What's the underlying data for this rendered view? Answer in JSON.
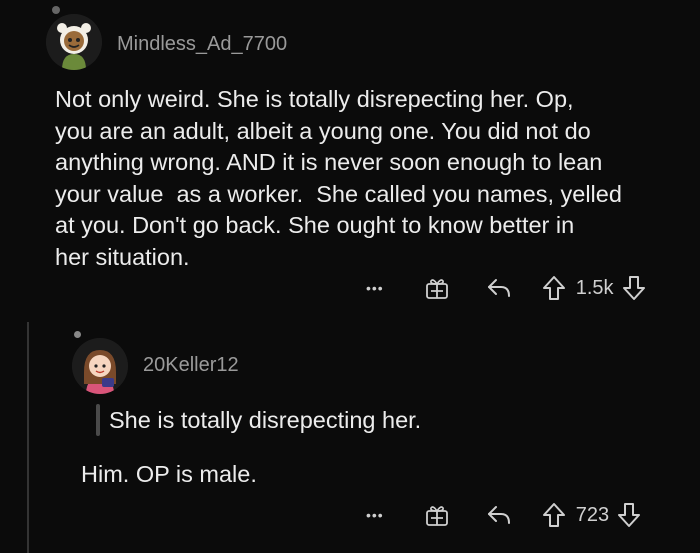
{
  "comments": [
    {
      "username": "Mindless_Ad_7700",
      "body": "Not only weird. She is totally disrepecting her. Op,\nyou are an adult, albeit a young one. You did not do\nanything wrong. AND it is never soon enough to lean\nyour value  as a worker.  She called you names, yelled\nat you. Don't go back. She ought to know better in\nher situation.",
      "actions": {
        "more": "•••",
        "vote_count": "1.5k"
      }
    },
    {
      "username": "20Keller12",
      "quote": "She is totally disrepecting her.",
      "body": "Him. OP is male.",
      "actions": {
        "more": "•••",
        "vote_count": "723"
      }
    }
  ],
  "icons": [
    "avatar",
    "award-icon",
    "reply-icon",
    "upvote-icon",
    "downvote-icon",
    "more-options-icon"
  ]
}
